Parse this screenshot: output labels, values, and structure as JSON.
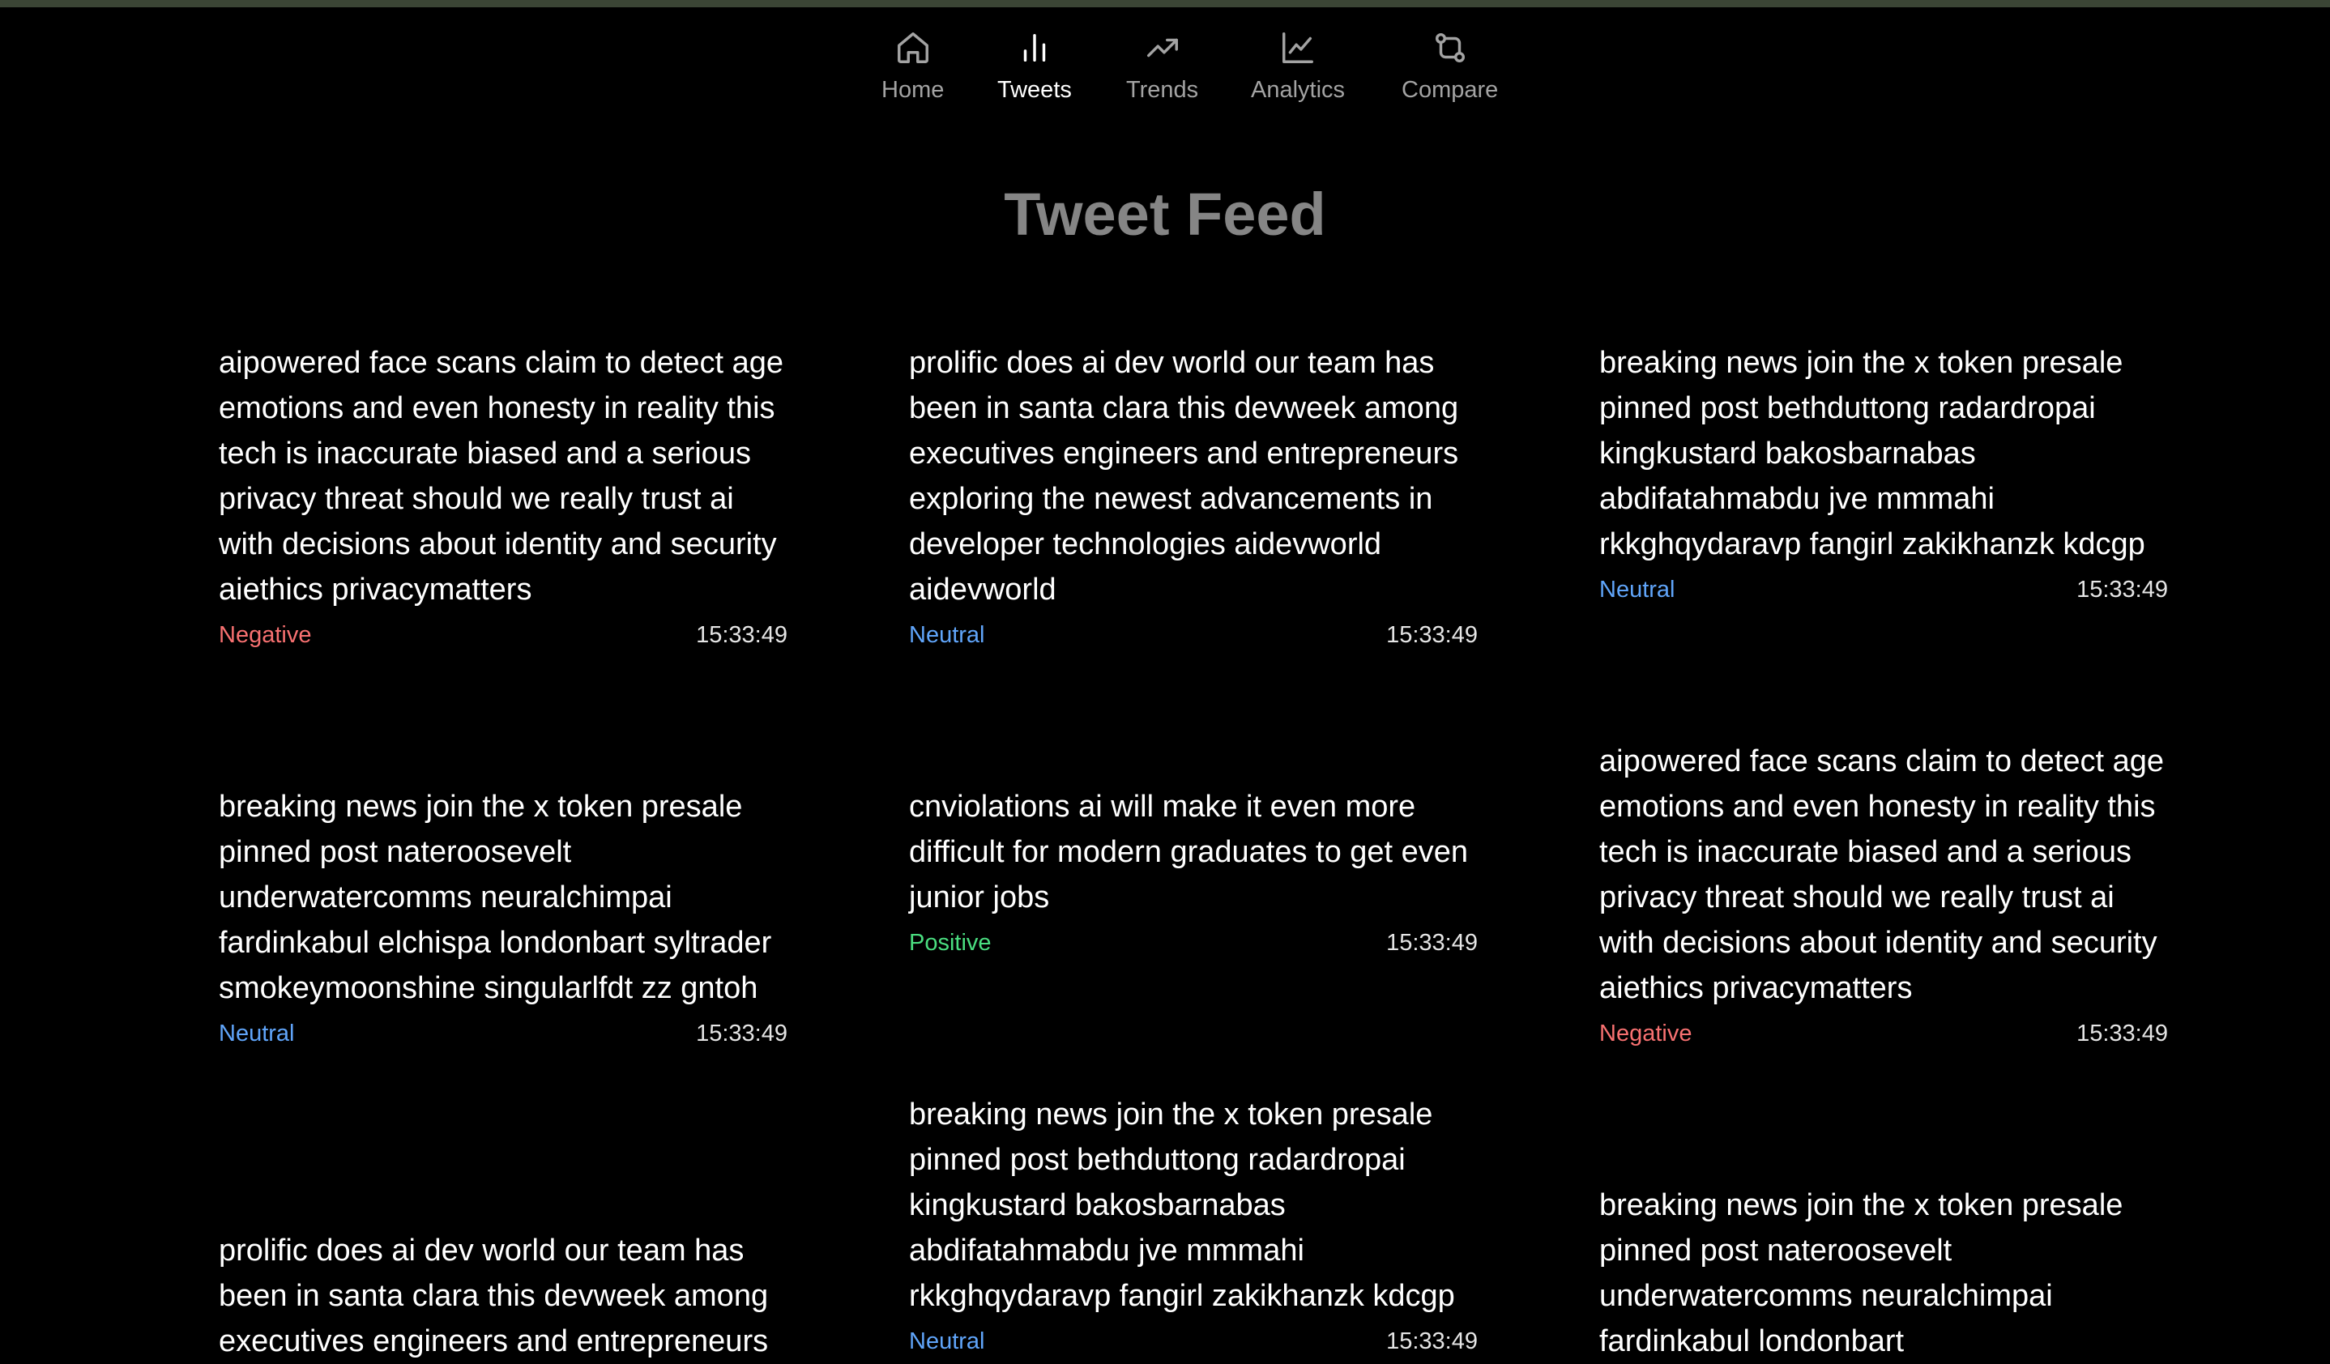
{
  "nav": {
    "items": [
      {
        "label": "Home",
        "icon": "home-icon"
      },
      {
        "label": "Tweets",
        "icon": "bar-chart-icon",
        "active": true
      },
      {
        "label": "Trends",
        "icon": "trending-up-icon"
      },
      {
        "label": "Analytics",
        "icon": "line-chart-icon"
      },
      {
        "label": "Compare",
        "icon": "git-compare-icon"
      }
    ]
  },
  "page": {
    "title": "Tweet Feed"
  },
  "colors": {
    "negative": "#f87171",
    "neutral": "#60a5fa",
    "positive": "#4ade80"
  },
  "tweets": [
    {
      "text": "aipowered face scans claim to detect age emotions and even honesty in reality this tech is inaccurate biased and a serious privacy threat should we really trust ai with decisions about identity and security aiethics privacymatters",
      "sentiment": "Negative",
      "time": "15:33:49"
    },
    {
      "text": "prolific does ai dev world our team has been in santa clara this devweek among executives engineers and entrepreneurs exploring the newest advancements in developer technologies aidevworld aidevworld",
      "sentiment": "Neutral",
      "time": "15:33:49"
    },
    {
      "text": "breaking news join the x token presale pinned post bethduttong radardropai kingkustard bakosbarnabas abdifatahmabdu jve mmmahi rkkghqydaravp fangirl zakikhanzk kdcgp",
      "sentiment": "Neutral",
      "time": "15:33:49"
    },
    {
      "text": "breaking news join the x token presale pinned post nateroosevelt underwatercomms neuralchimpai fardinkabul elchispa londonbart syltrader smokeymoonshine singularlfdt zz gntoh",
      "sentiment": "Neutral",
      "time": "15:33:49"
    },
    {
      "text": "cnviolations ai will make it even more difficult for modern graduates to get even junior jobs",
      "sentiment": "Positive",
      "time": "15:33:49"
    },
    {
      "text": "aipowered face scans claim to detect age emotions and even honesty in reality this tech is inaccurate biased and a serious privacy threat should we really trust ai with decisions about identity and security aiethics privacymatters",
      "sentiment": "Negative",
      "time": "15:33:49"
    },
    {
      "text": "breaking news join the x token presale pinned post bethduttong radardropai kingkustard bakosbarnabas abdifatahmabdu jve mmmahi rkkghqydaravp fangirl zakikhanzk kdcgp",
      "sentiment": "Neutral",
      "time": "15:33:49"
    },
    {
      "text": "prolific does ai dev world our team has been in santa clara this devweek among executives engineers and entrepreneurs",
      "sentiment": "",
      "time": ""
    },
    {
      "text": "breaking news join the x token presale pinned post nateroosevelt underwatercomms neuralchimpai fardinkabul londonbart",
      "sentiment": "",
      "time": ""
    }
  ]
}
